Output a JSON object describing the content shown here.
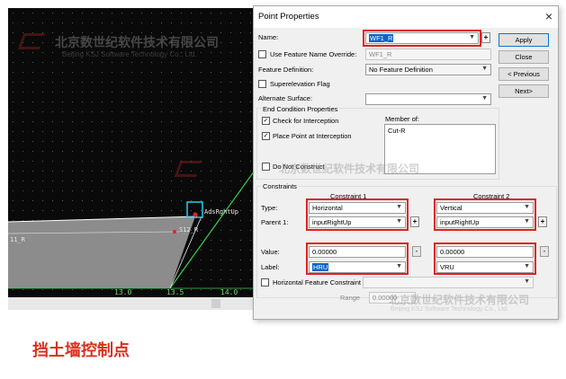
{
  "watermark": {
    "cn": "北京数世纪软件技术有限公司",
    "en": "Beijing KSJ Software Technology Co., Ltd."
  },
  "cad": {
    "labels": {
      "point_label": "AdsRghtUp",
      "point_label2": "S12_R",
      "left_label": "11_R"
    },
    "axis_ticks": [
      "13.0",
      "13.5",
      "14.0"
    ]
  },
  "caption": "挡土墙控制点",
  "dialog": {
    "title": "Point Properties",
    "close": "×",
    "name_label": "Name:",
    "name_value": "WF1_R",
    "buttons": {
      "apply": "Apply",
      "close": "Close",
      "previous": "< Previous",
      "next": "Next>"
    },
    "use_feature_override_label": "Use Feature Name Override:",
    "feature_override_value": "WF1_R",
    "feature_definition_label": "Feature Definition:",
    "feature_definition_value": "No Feature Definition",
    "superelevation_label": "Superelevation Flag",
    "alternate_surface_label": "Alternate Surface:",
    "end_condition": {
      "title": "End Condition Properties",
      "check_interception": "Check for Interception",
      "place_point": "Place Point at Interception",
      "member_of_label": "Member of:",
      "member_of_items": [
        "Cut-R"
      ],
      "do_not_construct": "Do Not Construct"
    },
    "constraints": {
      "title": "Constraints",
      "c1_header": "Constraint 1",
      "c2_header": "Constraint 2",
      "type_label": "Type:",
      "parent_label": "Parent 1:",
      "value_label": "Value:",
      "label_label": "Label:",
      "c1": {
        "type": "Horizontal",
        "parent": "inputRightUp",
        "value": "0.00000",
        "label": "HRU"
      },
      "c2": {
        "type": "Vertical",
        "parent": "inputRightUp",
        "value": "0.00000",
        "label": "VRU"
      },
      "horizontal_feature_label": "Horizontal Feature Constraint",
      "range_label": "Range",
      "range_value": "0.00000"
    }
  }
}
